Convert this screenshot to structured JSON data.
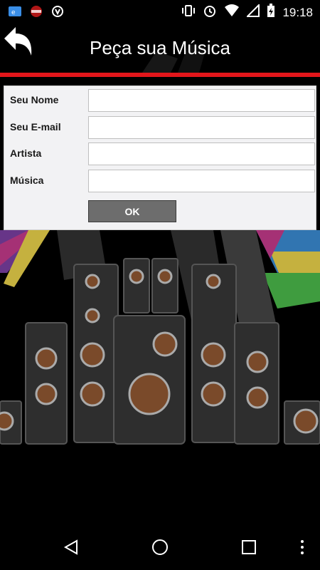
{
  "statusbar": {
    "time": "19:18"
  },
  "header": {
    "title": "Peça sua Música"
  },
  "form": {
    "name_label": "Seu Nome",
    "email_label": "Seu E-mail",
    "artist_label": "Artista",
    "song_label": "Música",
    "name_value": "",
    "email_value": "",
    "artist_value": "",
    "song_value": "",
    "ok_label": "OK"
  },
  "colors": {
    "accent": "#e3161b",
    "button": "#6d6d6d",
    "form_bg": "#f2f2f4"
  },
  "icons": [
    "app-icon",
    "radio-icon",
    "shield-icon",
    "vibrate-icon",
    "alarm-icon",
    "wifi-icon",
    "signal-icon",
    "battery-icon",
    "back-arrow-icon",
    "nav-back-icon",
    "nav-home-icon",
    "nav-recents-icon",
    "more-icon"
  ]
}
